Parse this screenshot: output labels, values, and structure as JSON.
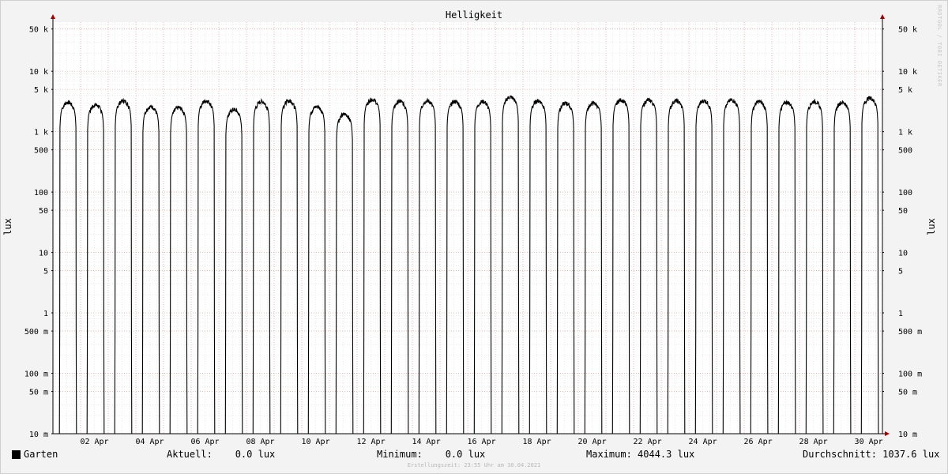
{
  "chart_data": {
    "type": "line",
    "title": "Helligkeit",
    "ylabel": "lux",
    "ylabel_right": "lux",
    "y_scale": "log",
    "ylim": [
      0.01,
      65000
    ],
    "xlim": [
      "2021-04-01T00:00",
      "2021-04-30T23:55"
    ],
    "grid": true,
    "y_ticks": [
      {
        "value": 50000,
        "label": "50 k"
      },
      {
        "value": 10000,
        "label": "10 k"
      },
      {
        "value": 5000,
        "label": "5 k"
      },
      {
        "value": 1000,
        "label": "1 k"
      },
      {
        "value": 500,
        "label": "500"
      },
      {
        "value": 100,
        "label": "100"
      },
      {
        "value": 50,
        "label": "50"
      },
      {
        "value": 10,
        "label": "10"
      },
      {
        "value": 5,
        "label": "5"
      },
      {
        "value": 1,
        "label": "1"
      },
      {
        "value": 0.5,
        "label": "500 m"
      },
      {
        "value": 0.1,
        "label": "100 m"
      },
      {
        "value": 0.05,
        "label": "50 m"
      },
      {
        "value": 0.01,
        "label": "10 m"
      }
    ],
    "x_ticks": [
      {
        "value": "2021-04-02",
        "label": "02 Apr"
      },
      {
        "value": "2021-04-04",
        "label": "04 Apr"
      },
      {
        "value": "2021-04-06",
        "label": "06 Apr"
      },
      {
        "value": "2021-04-08",
        "label": "08 Apr"
      },
      {
        "value": "2021-04-10",
        "label": "10 Apr"
      },
      {
        "value": "2021-04-12",
        "label": "12 Apr"
      },
      {
        "value": "2021-04-14",
        "label": "14 Apr"
      },
      {
        "value": "2021-04-16",
        "label": "16 Apr"
      },
      {
        "value": "2021-04-18",
        "label": "18 Apr"
      },
      {
        "value": "2021-04-20",
        "label": "20 Apr"
      },
      {
        "value": "2021-04-22",
        "label": "22 Apr"
      },
      {
        "value": "2021-04-24",
        "label": "24 Apr"
      },
      {
        "value": "2021-04-26",
        "label": "26 Apr"
      },
      {
        "value": "2021-04-28",
        "label": "28 Apr"
      },
      {
        "value": "2021-04-30",
        "label": "30 Apr"
      }
    ],
    "series": [
      {
        "name": "Garten",
        "color": "#000000",
        "daily_peaks_lux": [
          {
            "date": "2021-04-01",
            "peak": 3300
          },
          {
            "date": "2021-04-02",
            "peak": 3000
          },
          {
            "date": "2021-04-03",
            "peak": 3500
          },
          {
            "date": "2021-04-04",
            "peak": 2800
          },
          {
            "date": "2021-04-05",
            "peak": 2700
          },
          {
            "date": "2021-04-06",
            "peak": 3500
          },
          {
            "date": "2021-04-07",
            "peak": 2500
          },
          {
            "date": "2021-04-08",
            "peak": 3400
          },
          {
            "date": "2021-04-09",
            "peak": 3500
          },
          {
            "date": "2021-04-10",
            "peak": 2800
          },
          {
            "date": "2021-04-11",
            "peak": 2100
          },
          {
            "date": "2021-04-12",
            "peak": 3700
          },
          {
            "date": "2021-04-13",
            "peak": 3400
          },
          {
            "date": "2021-04-14",
            "peak": 3500
          },
          {
            "date": "2021-04-15",
            "peak": 3400
          },
          {
            "date": "2021-04-16",
            "peak": 3400
          },
          {
            "date": "2021-04-17",
            "peak": 4044.3
          },
          {
            "date": "2021-04-18",
            "peak": 3500
          },
          {
            "date": "2021-04-19",
            "peak": 3200
          },
          {
            "date": "2021-04-20",
            "peak": 3200
          },
          {
            "date": "2021-04-21",
            "peak": 3600
          },
          {
            "date": "2021-04-22",
            "peak": 3600
          },
          {
            "date": "2021-04-23",
            "peak": 3500
          },
          {
            "date": "2021-04-24",
            "peak": 3500
          },
          {
            "date": "2021-04-25",
            "peak": 3600
          },
          {
            "date": "2021-04-26",
            "peak": 3400
          },
          {
            "date": "2021-04-27",
            "peak": 3300
          },
          {
            "date": "2021-04-28",
            "peak": 3400
          },
          {
            "date": "2021-04-29",
            "peak": 3300
          },
          {
            "date": "2021-04-30",
            "peak": 3900
          }
        ]
      }
    ]
  },
  "legend": {
    "series_name": "Garten",
    "current": "Aktuell:    0.0 lux",
    "minimum": "Minimum:    0.0 lux",
    "maximum": "Maximum: 4044.3 lux",
    "average": "Durchschnitt: 1037.6 lux"
  },
  "footer": "Erstellungszeit: 23:55 Uhr am 30.04.2021",
  "watermark": "RRDTOOL / TOBI OETIKER",
  "colors": {
    "background": "#f3f3f3",
    "canvas": "#ffffff",
    "minor_grid": "#dddddd",
    "major_grid": "#e8a0a0",
    "axis": "#000000",
    "arrow": "#a00000",
    "line": "#000000"
  }
}
